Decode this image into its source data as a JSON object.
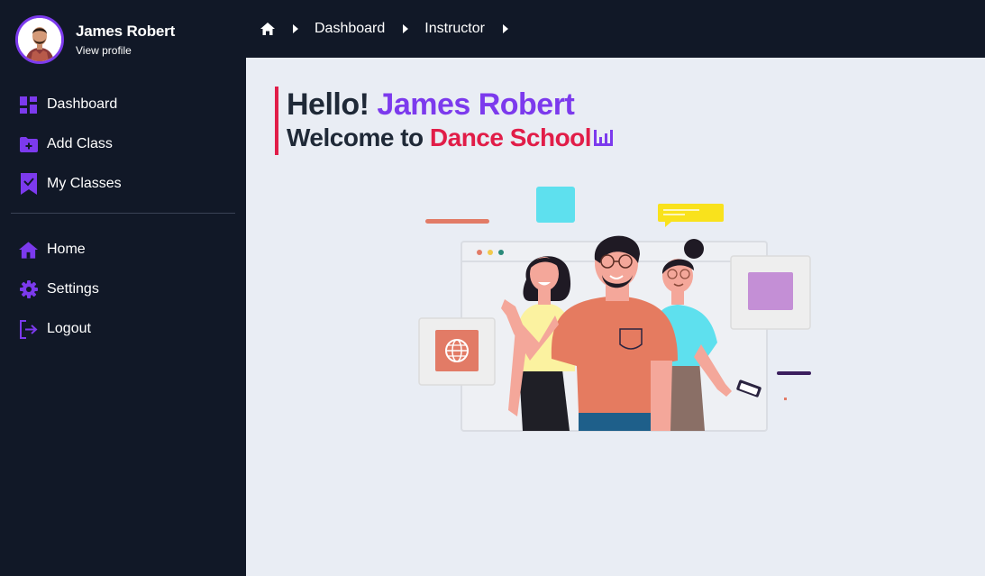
{
  "profile": {
    "name": "James Robert",
    "link": "View profile"
  },
  "sidebar": {
    "top_items": [
      {
        "label": "Dashboard",
        "icon": "dashboard-icon"
      },
      {
        "label": "Add Class",
        "icon": "folder-add-icon"
      },
      {
        "label": "My Classes",
        "icon": "bookmark-check-icon"
      }
    ],
    "bottom_items": [
      {
        "label": "Home",
        "icon": "home-icon"
      },
      {
        "label": "Settings",
        "icon": "gear-icon"
      },
      {
        "label": "Logout",
        "icon": "logout-icon"
      }
    ]
  },
  "breadcrumb": {
    "items": [
      "Dashboard",
      "Instructor"
    ]
  },
  "greeting": {
    "hello": "Hello!",
    "name": "James Robert",
    "welcome": "Welcome to",
    "school": "Dance School"
  },
  "colors": {
    "sidebar_bg": "#111827",
    "accent_purple": "#7c3aed",
    "accent_red": "#e11d48",
    "content_bg": "#e9edf4"
  }
}
